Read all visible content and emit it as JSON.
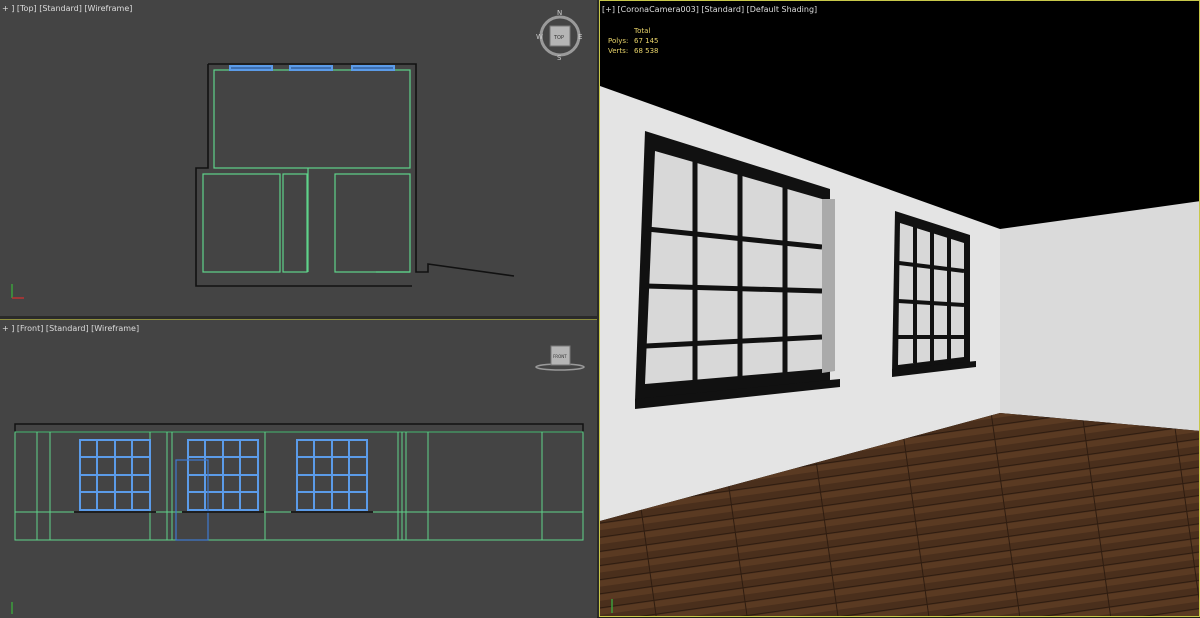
{
  "viewports": {
    "top": {
      "plus": "+",
      "view": "Top",
      "mode": "Standard",
      "shading": "Wireframe"
    },
    "front": {
      "plus": "+",
      "view": "Front",
      "mode": "Standard",
      "shading": "Wireframe"
    },
    "camera": {
      "plus": "+",
      "view": "CoronaCamera003",
      "mode": "Standard",
      "shading": "Default Shading"
    }
  },
  "viewcube": {
    "compass": {
      "n": "N",
      "s": "S",
      "e": "E",
      "w": "W"
    },
    "top_face": "TOP",
    "front_face": "FRONT"
  },
  "stats": {
    "header": "Total",
    "polys_label": "Polys:",
    "polys_value": "67 145",
    "verts_label": "Verts:",
    "verts_value": "68 538"
  },
  "colors": {
    "viewport_bg": "#444444",
    "wire_green": "#5fd38a",
    "wire_blue": "#5b9be8",
    "wall_black": "#111111",
    "active_border": "#c8c84a",
    "stats_text": "#e8d36a"
  },
  "icons": [
    "compass-icon",
    "viewcube-icon",
    "axis-gizmo-icon"
  ]
}
